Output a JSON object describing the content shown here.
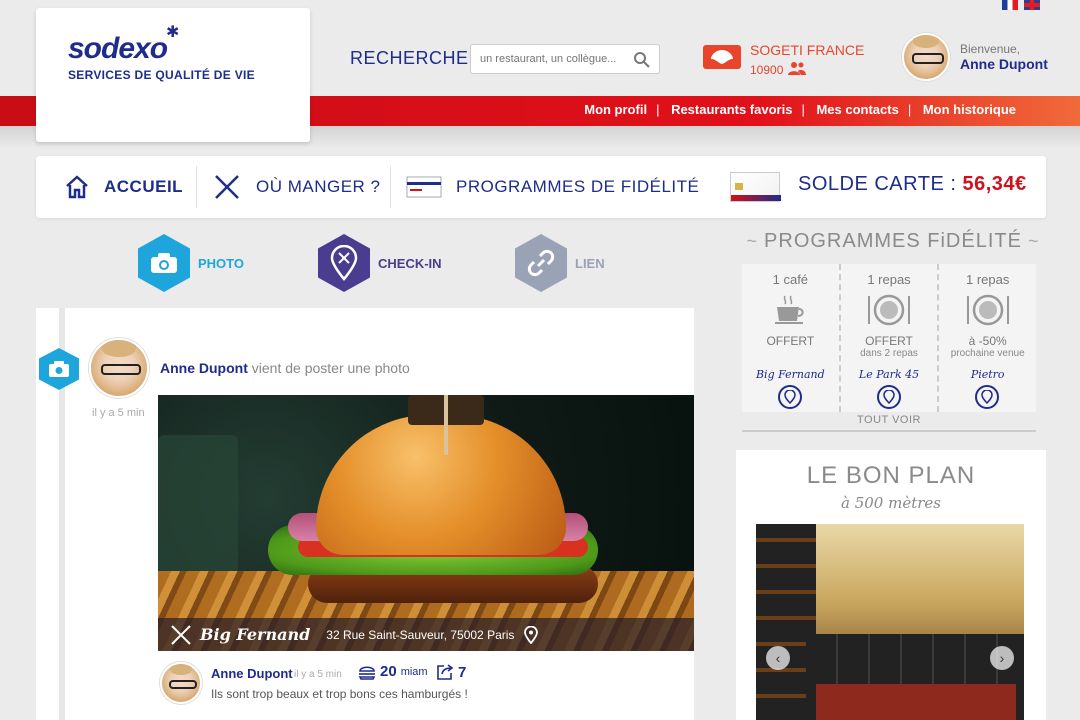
{
  "header": {
    "brand": "sodexo",
    "tagline": "SERVICES DE QUALITÉ DE VIE",
    "search_label": "RECHERCHER",
    "search_placeholder": "un restaurant, un collègue...",
    "company_name": "SOGETI FRANCE",
    "company_count": "10900",
    "welcome": "Bienvenue,",
    "user_name": "Anne Dupont",
    "links": [
      "Mon profil",
      "Restaurants favoris",
      "Mes contacts",
      "Mon historique"
    ]
  },
  "nav": {
    "home": "ACCUEIL",
    "where_to_eat": "OÙ MANGER ?",
    "loyalty": "PROGRAMMES DE FIDÉLITÉ",
    "balance_label": "SOLDE CARTE :",
    "balance_value": "56,34€"
  },
  "post_tabs": {
    "photo": "PHOTO",
    "checkin": "CHECK-IN",
    "link": "LIEN"
  },
  "post": {
    "author": "Anne Dupont",
    "action": "vient de poster une photo",
    "time": "il y a 5 min",
    "restaurant": "Big Fernand",
    "address": "32 Rue Saint-Sauveur, 75002 Paris"
  },
  "comment": {
    "author": "Anne Dupont",
    "time": "il y a 5 min",
    "likes": "20",
    "likes_unit": "miam",
    "shares": "7",
    "text": "Ils sont trop beaux et trop bons ces hamburgés !"
  },
  "loyalty": {
    "title": "PROGRAMMES FiDÉLITÉ",
    "see_all": "TOUT VOIR",
    "items": [
      {
        "title": "1 café",
        "offer": "OFFERT",
        "sub": "",
        "restaurant": "Big Fernand",
        "icon": "coffee-cup-icon"
      },
      {
        "title": "1 repas",
        "offer": "OFFERT",
        "sub": "dans 2 repas",
        "restaurant": "Le Park 45",
        "icon": "plate-icon"
      },
      {
        "title": "1 repas",
        "offer": "à -50%",
        "sub": "prochaine venue",
        "restaurant": "Pietro",
        "icon": "plate-icon"
      }
    ]
  },
  "deal": {
    "title": "LE BON PLAN",
    "subtitle": "à 500 mètres"
  },
  "colors": {
    "brand_blue": "#1e2c8c",
    "brand_red": "#d0101a",
    "photo_blue": "#1ea6dc",
    "checkin_purple": "#4a3d8f",
    "link_grey": "#9aa3b5"
  }
}
